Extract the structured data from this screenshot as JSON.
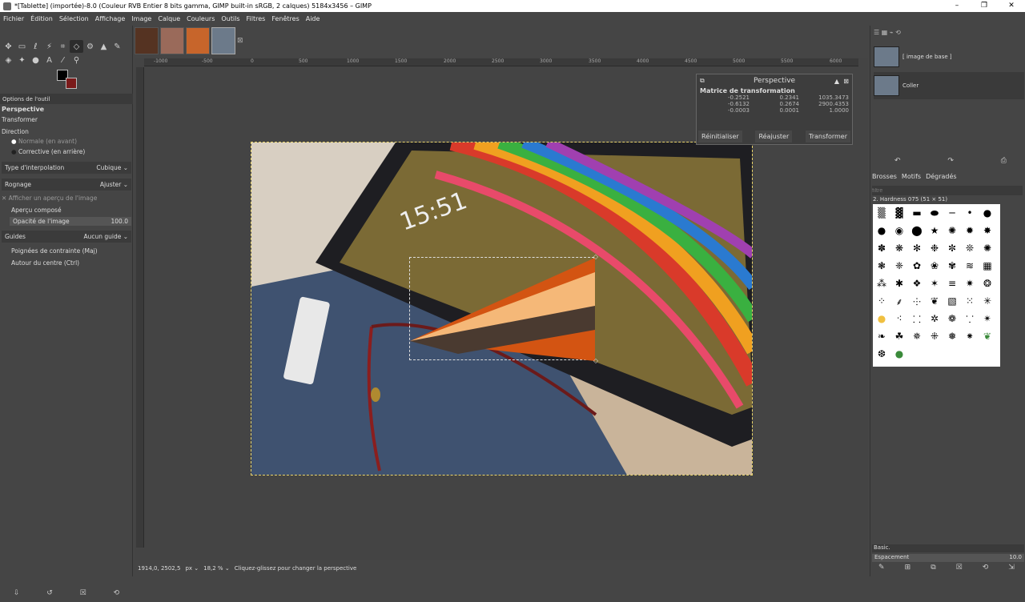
{
  "window": {
    "title": "*[Tablette] (importée)-8.0 (Couleur RVB Entier 8 bits gamma, GIMP built-in sRGB, 2 calques) 5184x3456 – GIMP"
  },
  "menu": [
    "Fichier",
    "Édition",
    "Sélection",
    "Affichage",
    "Image",
    "Calque",
    "Couleurs",
    "Outils",
    "Filtres",
    "Fenêtres",
    "Aide"
  ],
  "tool_options": {
    "tab": "Options de l'outil",
    "title": "Perspective",
    "transformer": "Transformer",
    "direction": "Direction",
    "dir_normal": "Normale (en avant)",
    "dir_corrective": "Corrective (en arrière)",
    "interp_label": "Type d'interpolation",
    "interp_value": "Cubique",
    "crop_label": "Rognage",
    "crop_value": "Ajuster",
    "show_preview": "Afficher un aperçu de l'image",
    "composite": "Aperçu composé",
    "opacity_label": "Opacité de l'image",
    "opacity_value": "100.0",
    "guides_label": "Guides",
    "guides_value": "Aucun guide",
    "constrain": "Poignées de contrainte (Maj)",
    "center": "Autour du centre (Ctrl)"
  },
  "perspective_dialog": {
    "title": "Perspective",
    "subtitle": "Matrice de transformation",
    "matrix": [
      [
        "-0.2521",
        "0.2341",
        "1035.3473"
      ],
      [
        "-0.6132",
        "0.2674",
        "2900.4353"
      ],
      [
        "-0.0003",
        "0.0001",
        "1.0000"
      ]
    ],
    "btn_reset": "Réinitialiser",
    "btn_readjust": "Réajuster",
    "btn_transform": "Transformer"
  },
  "ruler": [
    "-1000",
    "-500",
    "0",
    "500",
    "1000",
    "1500",
    "2000",
    "2500",
    "3000",
    "3500",
    "4000",
    "4500",
    "5000",
    "5500",
    "6000"
  ],
  "status": {
    "coords": "1914,0, 2502,5",
    "unit": "px",
    "zoom": "18,2 %",
    "message": "Cliquez-glissez pour changer la perspective"
  },
  "layers": [
    {
      "name": "[ image de base ]"
    },
    {
      "name": "Coller"
    }
  ],
  "brushes": {
    "tabs": [
      "Brosses",
      "Motifs",
      "Dégradés"
    ],
    "filter_placeholder": "filtre",
    "current": "2. Hardness 075 (51 × 51)",
    "preset": "Basic.",
    "spacing_label": "Espacement",
    "spacing_value": "10.0"
  }
}
